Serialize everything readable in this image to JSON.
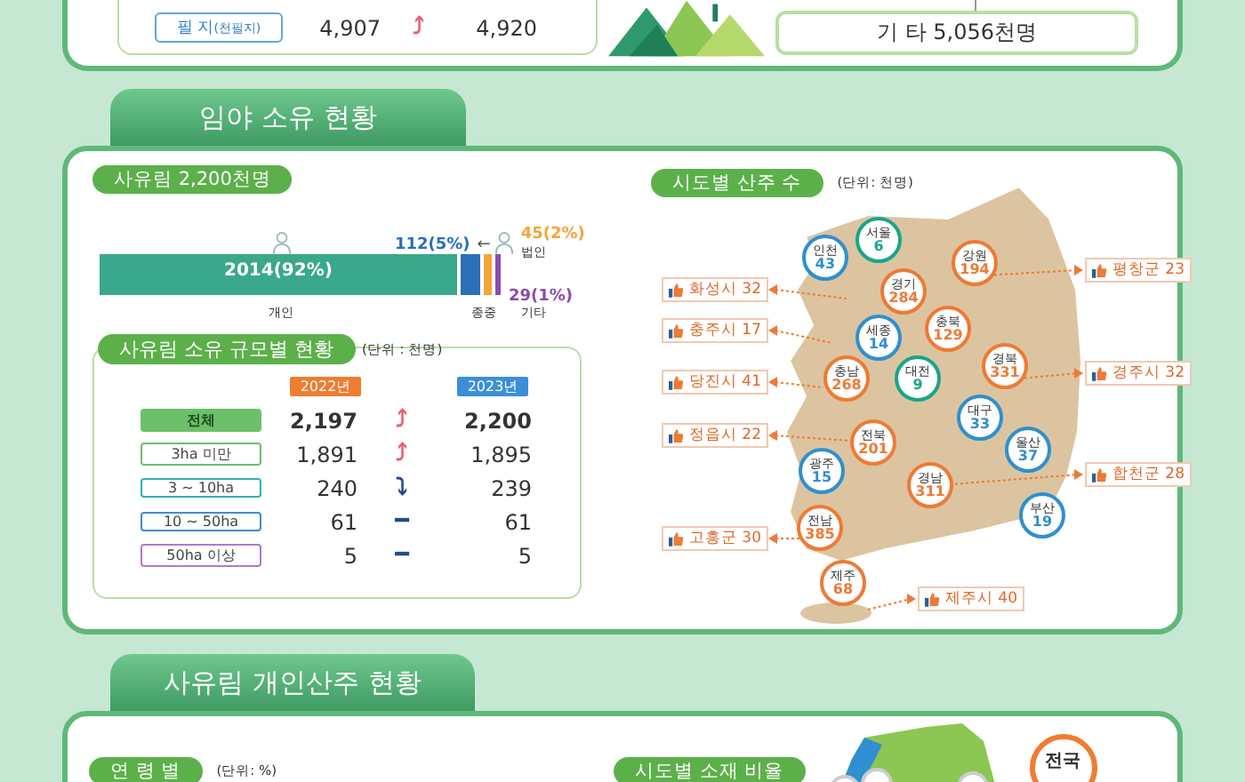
{
  "top_card": {
    "rows": [
      {
        "label": "필 지",
        "unit": "(천필지)",
        "v2022": "4,907",
        "trend": {
          "glyph": "⤴",
          "color": "#e8607a"
        },
        "v2023": "4,920"
      }
    ],
    "other": "기 타 5,056천명"
  },
  "ownership_section": {
    "title": "임야 소유 현황"
  },
  "private_forest": {
    "title": "사유림 2,200천명",
    "arrow": "←",
    "segments": [
      {
        "value": "2014(92%)",
        "label": "개인",
        "color": "#3aa88a"
      },
      {
        "value": "112(5%)",
        "label": "종중",
        "color": "#2a6fb8"
      },
      {
        "value": "45(2%)",
        "label": "법인",
        "color": "#f4a53a"
      },
      {
        "value": "29(1%)",
        "label": "기타",
        "color": "#8a4bb0"
      }
    ]
  },
  "scale_table": {
    "title": "사유림 소유 규모별 현황",
    "unit": "(단위 : 천명)",
    "years": [
      "2022년",
      "2023년"
    ],
    "rows": [
      {
        "kind": "total",
        "label": "전체",
        "color": "#6cc06a",
        "v2022": "2,197",
        "trend": {
          "glyph": "⤴",
          "color": "#e8607a"
        },
        "v2023": "2,200"
      },
      {
        "kind": "size",
        "label": "3ha 미만",
        "color": "#6cc06a",
        "v2022": "1,891",
        "trend": {
          "glyph": "⤴",
          "color": "#e8607a"
        },
        "v2023": "1,895"
      },
      {
        "kind": "size",
        "label": "3 ~ 10ha",
        "color": "#2fb0b8",
        "v2022": "240",
        "trend": {
          "glyph": "⤵",
          "color": "#1f4d8c"
        },
        "v2023": "239"
      },
      {
        "kind": "size",
        "label": "10 ~ 50ha",
        "color": "#3b8fd6",
        "v2022": "61",
        "trend": {
          "glyph": "━",
          "color": "#1f4d8c"
        },
        "v2023": "61"
      },
      {
        "kind": "size",
        "label": "50ha 이상",
        "color": "#b07ac8",
        "v2022": "5",
        "trend": {
          "glyph": "━",
          "color": "#1f4d8c"
        },
        "v2023": "5"
      }
    ]
  },
  "region_map": {
    "title": "시도별 산주 수",
    "unit": "(단위: 천명)",
    "pins": [
      {
        "name": "인천",
        "value": "43",
        "color": "#2f8fd0"
      },
      {
        "name": "서울",
        "value": "6",
        "color": "#19a58a"
      },
      {
        "name": "강원",
        "value": "194",
        "color": "#ee7a35"
      },
      {
        "name": "경기",
        "value": "284",
        "color": "#ee7a35"
      },
      {
        "name": "충북",
        "value": "129",
        "color": "#ee7a35"
      },
      {
        "name": "세종",
        "value": "14",
        "color": "#2f8fd0"
      },
      {
        "name": "충남",
        "value": "268",
        "color": "#ee7a35"
      },
      {
        "name": "대전",
        "value": "9",
        "color": "#19a58a"
      },
      {
        "name": "경북",
        "value": "331",
        "color": "#ee7a35"
      },
      {
        "name": "대구",
        "value": "33",
        "color": "#2f8fd0"
      },
      {
        "name": "울산",
        "value": "37",
        "color": "#2f8fd0"
      },
      {
        "name": "전북",
        "value": "201",
        "color": "#ee7a35"
      },
      {
        "name": "광주",
        "value": "15",
        "color": "#2f8fd0"
      },
      {
        "name": "경남",
        "value": "311",
        "color": "#ee7a35"
      },
      {
        "name": "부산",
        "value": "19",
        "color": "#2f8fd0"
      },
      {
        "name": "전남",
        "value": "385",
        "color": "#ee7a35"
      },
      {
        "name": "제주",
        "value": "68",
        "color": "#ee7a35"
      }
    ],
    "callouts": [
      "화성시 32",
      "충주시 17",
      "당진시 41",
      "정읍시 22",
      "고흥군 30",
      "평창군 23",
      "경주시 32",
      "합천군 28",
      "제주시 40"
    ]
  },
  "individual_section": {
    "title": "사유림 개인산주 현황",
    "age": {
      "title": "연 령 별",
      "unit": "(단위: %)"
    },
    "region_share": {
      "title": "시도별 소재 비율",
      "national": "전국"
    }
  }
}
